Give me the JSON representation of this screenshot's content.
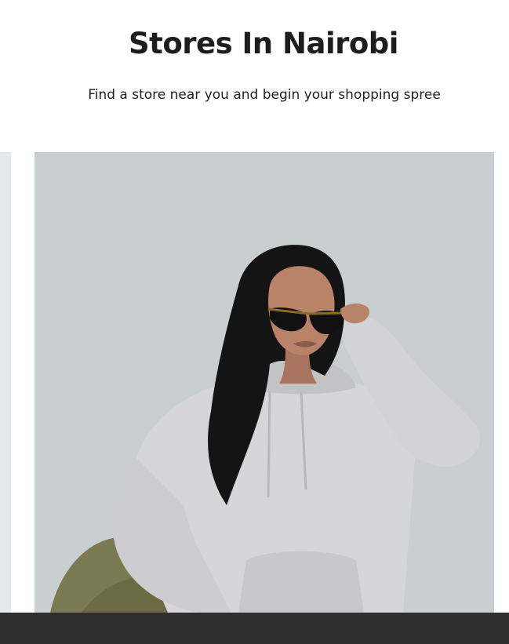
{
  "header": {
    "title": "Stores In Nairobi",
    "subtitle": "Find a store near you and begin your shopping spree"
  },
  "carousel": {
    "slides": [
      {
        "description_icon": "store-model-photo"
      }
    ]
  },
  "colors": {
    "background": "#ffffff",
    "title_text": "#1d1d1d",
    "photo_backdrop": "#c9cfd0",
    "bottom_bar": "#2f2f2f"
  }
}
